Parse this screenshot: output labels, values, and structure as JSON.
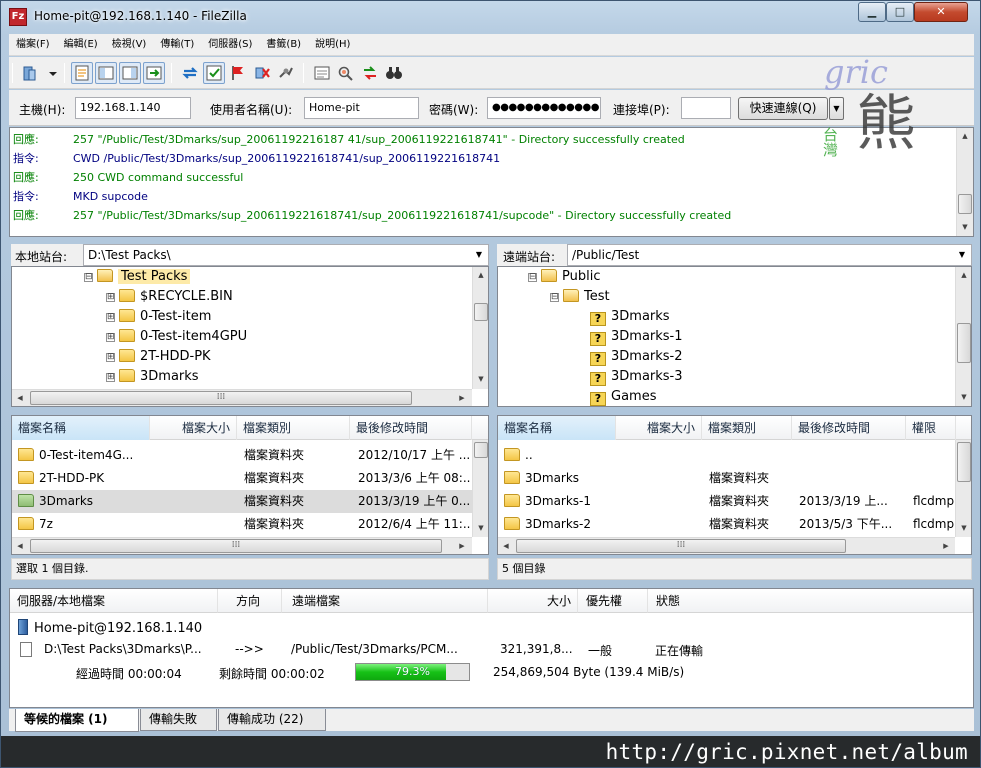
{
  "window": {
    "title": "Home-pit@192.168.1.140 - FileZilla",
    "app_icon_text": "Fz",
    "min_label": "▁",
    "max_label": "□",
    "close_label": "✕"
  },
  "menu": [
    "檔案(F)",
    "編輯(E)",
    "檢視(V)",
    "傳輸(T)",
    "伺服器(S)",
    "書籤(B)",
    "說明(H)"
  ],
  "quickconnect": {
    "host_label": "主機(H):",
    "host_value": "192.168.1.140",
    "user_label": "使用者名稱(U):",
    "user_value": "Home-pit",
    "pass_label": "密碼(W):",
    "pass_value": "●●●●●●●●●●●●●",
    "port_label": "連接埠(P):",
    "port_value": "",
    "button_label": "快速連線(Q)",
    "dropdown_label": "▼"
  },
  "watermark": {
    "logo_text_top": "gric",
    "logo_text_side": "台灣",
    "logo_text_main": "熊"
  },
  "log": [
    {
      "type": "回應:",
      "kind": "resp",
      "text": "257 \"/Public/Test/3Dmarks/sup_20061192216187 41/sup_2006119221618741\" - Directory successfully created"
    },
    {
      "type": "指令:",
      "kind": "cmd",
      "text": "CWD /Public/Test/3Dmarks/sup_2006119221618741/sup_2006119221618741"
    },
    {
      "type": "回應:",
      "kind": "resp",
      "text": "250 CWD command successful"
    },
    {
      "type": "指令:",
      "kind": "cmd",
      "text": "MKD supcode"
    },
    {
      "type": "回應:",
      "kind": "resp",
      "text": "257 \"/Public/Test/3Dmarks/sup_2006119221618741/sup_2006119221618741/supcode\" - Directory successfully created"
    }
  ],
  "local": {
    "site_label": "本地站台:",
    "site_path": "D:\\Test Packs\\",
    "tree": [
      {
        "label": "Test Packs",
        "expander": "⊟",
        "open": true,
        "selected": true
      },
      {
        "label": "$RECYCLE.BIN",
        "expander": "⊞"
      },
      {
        "label": "0-Test-item",
        "expander": "⊞"
      },
      {
        "label": "0-Test-item4GPU",
        "expander": "⊞"
      },
      {
        "label": "2T-HDD-PK",
        "expander": "⊞"
      },
      {
        "label": "3Dmarks",
        "expander": "⊞"
      }
    ],
    "columns": [
      "檔案名稱",
      "檔案大小",
      "檔案類別",
      "最後修改時間"
    ],
    "rows": [
      {
        "name": "0-Test-item4G...",
        "size": "",
        "type": "檔案資料夾",
        "modified": "2012/10/17 上午 ..."
      },
      {
        "name": "2T-HDD-PK",
        "size": "",
        "type": "檔案資料夾",
        "modified": "2013/3/6 上午 08:..."
      },
      {
        "name": "3Dmarks",
        "size": "",
        "type": "檔案資料夾",
        "modified": "2013/3/19 上午 0..."
      },
      {
        "name": "7z",
        "size": "",
        "type": "檔案資料夾",
        "modified": "2012/6/4 上午 11:..."
      }
    ],
    "status": "選取 1 個目錄."
  },
  "remote": {
    "site_label": "遠端站台:",
    "site_path": "/Public/Test",
    "tree": [
      {
        "label": "Public",
        "expander": "⊟",
        "kind": "open"
      },
      {
        "label": "Test",
        "expander": "⊟",
        "kind": "open"
      },
      {
        "label": "3Dmarks",
        "kind": "unknown"
      },
      {
        "label": "3Dmarks-1",
        "kind": "unknown"
      },
      {
        "label": "3Dmarks-2",
        "kind": "unknown"
      },
      {
        "label": "3Dmarks-3",
        "kind": "unknown"
      },
      {
        "label": "Games",
        "kind": "unknown"
      }
    ],
    "columns": [
      "檔案名稱",
      "檔案大小",
      "檔案類別",
      "最後修改時間",
      "權限"
    ],
    "rows": [
      {
        "name": "..",
        "size": "",
        "type": "",
        "modified": "",
        "perm": ""
      },
      {
        "name": "3Dmarks",
        "size": "",
        "type": "檔案資料夾",
        "modified": "",
        "perm": ""
      },
      {
        "name": "3Dmarks-1",
        "size": "",
        "type": "檔案資料夾",
        "modified": "2013/3/19 上...",
        "perm": "flcdmp"
      },
      {
        "name": "3Dmarks-2",
        "size": "",
        "type": "檔案資料夾",
        "modified": "2013/5/3 下午...",
        "perm": "flcdmp"
      }
    ],
    "status": "5 個目錄"
  },
  "queue": {
    "columns": [
      "伺服器/本地檔案",
      "方向",
      "遠端檔案",
      "大小",
      "優先權",
      "狀態"
    ],
    "server": "Home-pit@192.168.1.140",
    "file": {
      "local": "D:\\Test Packs\\3Dmarks\\P...",
      "direction": "-->>",
      "remote": "/Public/Test/3Dmarks/PCM...",
      "size": "321,391,8...",
      "priority": "一般",
      "status": "正在傳輸"
    },
    "elapsed": "經過時間 00:00:04",
    "remaining": "剩餘時間 00:00:02",
    "progress_percent": 79.3,
    "progress_label": "79.3%",
    "transferred": "254,869,504 Byte (139.4 MiB/s)"
  },
  "tabs": [
    {
      "label": "等候的檔案 (1)",
      "active": true
    },
    {
      "label": "傳輸失敗",
      "active": false
    },
    {
      "label": "傳輸成功 (22)",
      "active": false
    }
  ],
  "banner_url": "http://gric.pixnet.net/album",
  "colors": {
    "progress": "#17c217",
    "response": "#008000",
    "command": "#000080"
  }
}
